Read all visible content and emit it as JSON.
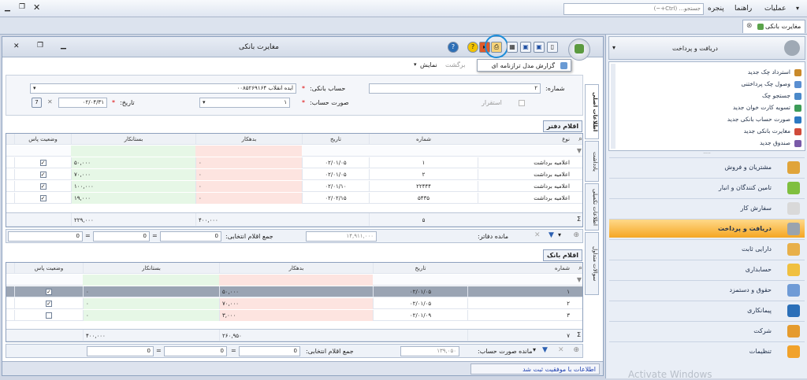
{
  "menubar": {
    "items": [
      "عملیات",
      "راهنما",
      "پنجره"
    ],
    "search_placeholder": "جستجو... (Ctrl+~)"
  },
  "tabstrip": {
    "active_tab": "مغایرت بانکی"
  },
  "window": {
    "title": "مغایرت بانکی",
    "tooltip": "گزارش مدل ترازنامه ای",
    "toolbar": {
      "show_label": "نمایش",
      "back_label": "برگشت"
    },
    "side_tabs": [
      "اطلاعات اصلی",
      "اطلاعات تکمیلی",
      "یادداشت",
      "سوالات متداول"
    ]
  },
  "form": {
    "number_label": "شماره:",
    "number_value": "۲",
    "bank_account_label": "حساب بانکی:",
    "bank_account_value": "ایده انقلاب ۰۰۸۵۲۶۹۱۶۴",
    "statement_label": "صورت حساب:",
    "statement_value": "۱",
    "date_label": "تاریخ:",
    "date_value": "۰۲/۰۴/۳۱",
    "establish_label": "استقرار",
    "star": "*"
  },
  "ledger": {
    "title": "اقلام دفتر",
    "columns": [
      "نوع",
      "شماره",
      "تاریخ",
      "بدهکار",
      "بستانکار",
      "وضعیت پاس"
    ],
    "rows": [
      [
        "اعلامیه برداشت",
        "۱",
        "۰۲/۰۱/۰۵",
        "۰",
        "۵۰,۰۰۰",
        true
      ],
      [
        "اعلامیه برداشت",
        "۲",
        "۰۲/۰۱/۰۵",
        "۰",
        "۷۰,۰۰۰",
        true
      ],
      [
        "اعلامیه برداشت",
        "۲۲۴۴۴",
        "۰۲/۰۱/۱۰",
        "۰",
        "۱۰۰,۰۰۰",
        true
      ],
      [
        "اعلامیه برداشت",
        "۵۴۳۵",
        "۰۲/۰۲/۱۵",
        "۰",
        "۱۹,۰۰۰",
        true
      ]
    ],
    "totals": {
      "count": "۵",
      "debit": "۴۰۰,۰۰۰",
      "credit": "۲۲۹,۰۰۰"
    },
    "remain_label": "مانده دفاتر:",
    "remain_value": "۱۴,۹۱۱,۰۰۰",
    "selected_label": "جمع اقلام انتخابی:",
    "sel_a": "0",
    "sel_b": "0",
    "sel_c": "0"
  },
  "bank": {
    "title": "اقلام بانک",
    "columns": [
      "شماره",
      "تاریخ",
      "بدهکار",
      "بستانکار",
      "وضعیت پاس"
    ],
    "rows": [
      [
        "۱",
        "۰۲/۰۱/۰۵",
        "۵۰,۰۰۰",
        "۰",
        true
      ],
      [
        "۲",
        "۰۲/۰۱/۰۵",
        "۷۰,۰۰۰",
        "۰",
        true
      ],
      [
        "۳",
        "۰۲/۰۱/۰۹",
        "۳,۰۰۰",
        "۰",
        false
      ]
    ],
    "totals": {
      "count": "۷",
      "debit": "۲۶۰,۹۵۰",
      "credit": "۴۰۰,۰۰۰"
    },
    "remain_label": "مانده صورت حساب:",
    "remain_value": "۱۳۹,۰۵۰",
    "selected_label": "جمع اقلام انتخابی:",
    "sel_a": "0",
    "sel_b": "0",
    "sel_c": "0"
  },
  "status": {
    "message": "اطلاعات با موفقیت ثبت شد"
  },
  "sidebar": {
    "header": "دریافت و پرداخت",
    "tree": [
      "استرداد چک جدید",
      "وصول چک پرداختنی",
      "جستجو چک",
      "تسویه کارت خوان جدید",
      "صورت حساب بانکی جدید",
      "مغایرت بانکی جدید",
      "صندوق جدید"
    ],
    "modules": [
      "مشتریان و فروش",
      "تامین کنندگان و انبار",
      "سفارش کار",
      "دریافت و پرداخت",
      "دارایی ثابت",
      "حسابداری",
      "حقوق و دستمزد",
      "پیمانکاری",
      "شرکت",
      "تنظیمات"
    ],
    "active_module": "دریافت و پرداخت",
    "watermark": "Activate Windows"
  },
  "colors": {
    "accent": "#f5a623",
    "selected_row": "#9aa4b3",
    "debit_bg": "#fde4e0",
    "credit_bg": "#e6f7e6"
  }
}
